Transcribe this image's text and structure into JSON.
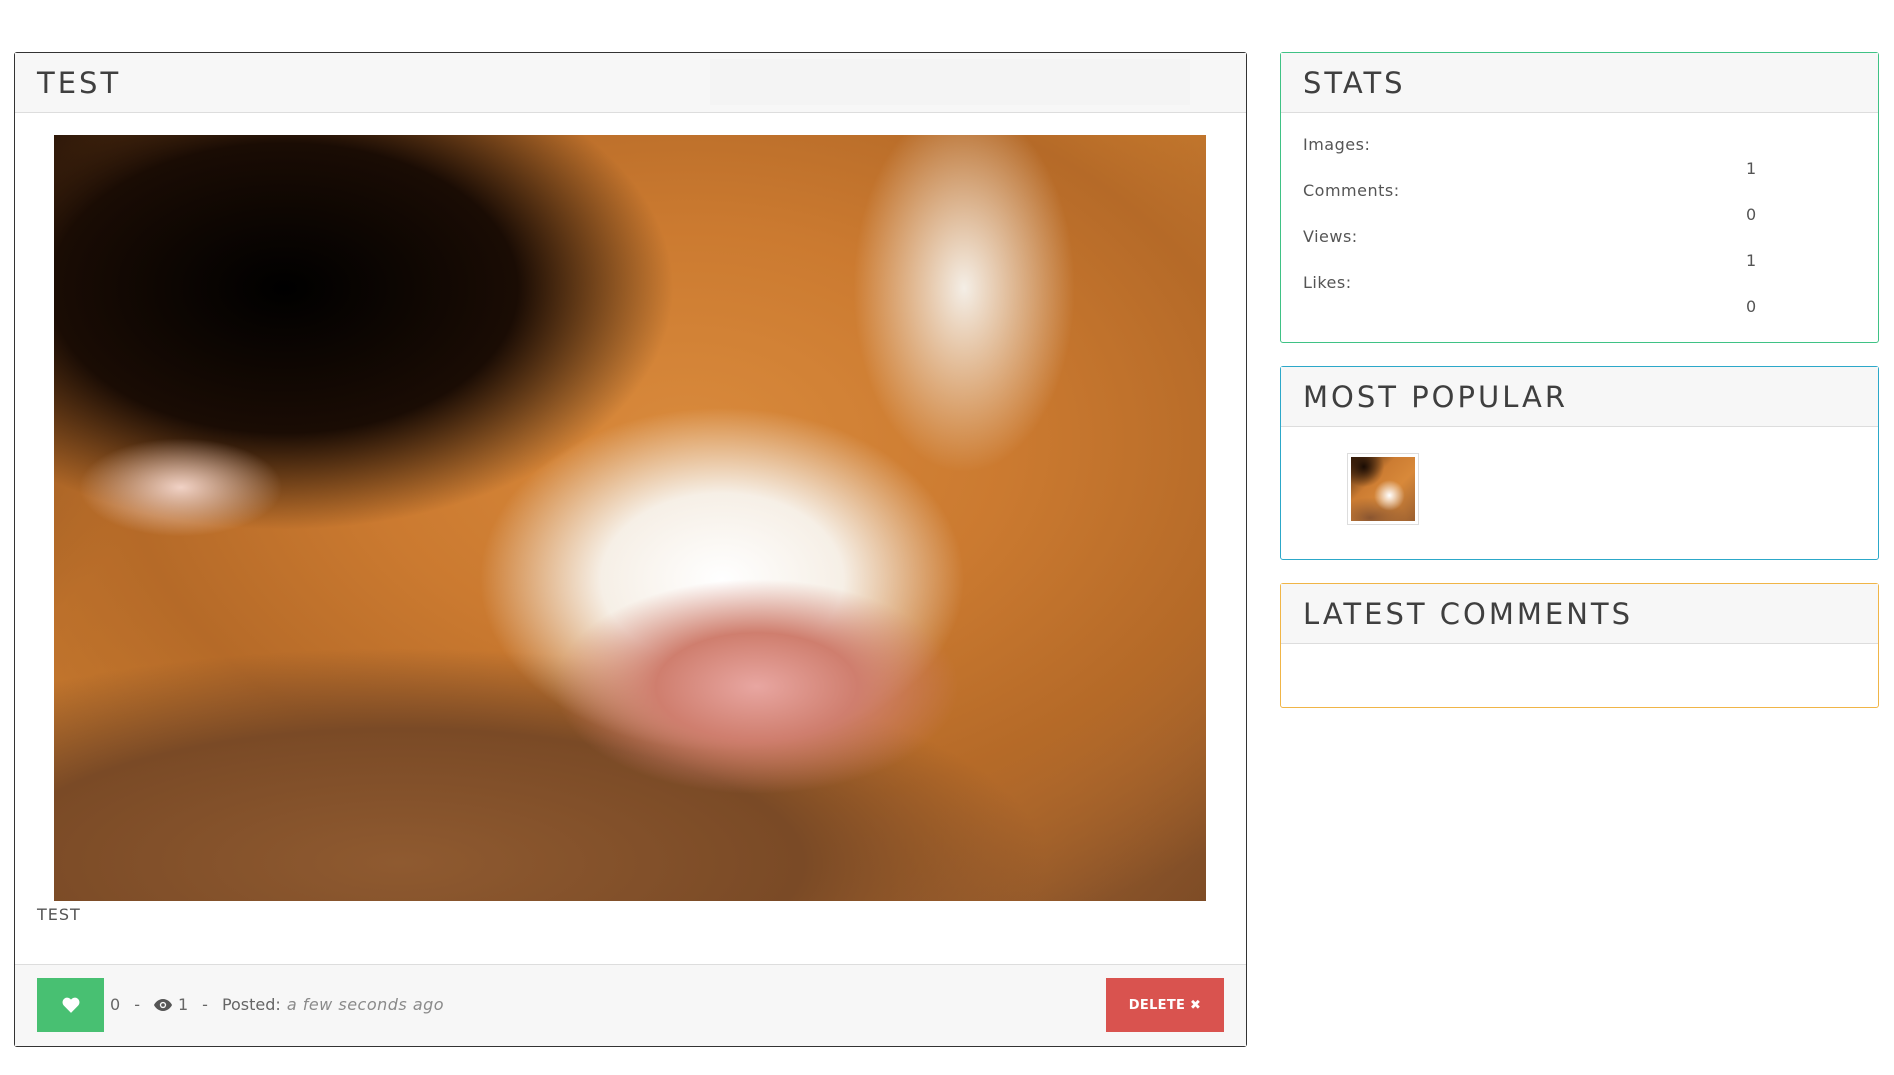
{
  "main": {
    "title": "TEST",
    "caption": "TEST",
    "likes": "0",
    "separator": "-",
    "views": "1",
    "posted_label": "Posted:",
    "posted_time": "a few seconds ago",
    "delete_label": "DELETE ✖",
    "like_icon": "heart-icon",
    "views_icon": "eye-icon",
    "colors": {
      "like": "#48c072",
      "delete": "#d9534f"
    }
  },
  "stats": {
    "title": "STATS",
    "items": [
      {
        "label": "Images:",
        "value": "1"
      },
      {
        "label": "Comments:",
        "value": "0"
      },
      {
        "label": "Views:",
        "value": "1"
      },
      {
        "label": "Likes:",
        "value": "0"
      }
    ],
    "border_color": "#3fc285"
  },
  "popular": {
    "title": "MOST POPULAR",
    "border_color": "#2ca8c9"
  },
  "comments": {
    "title": "LATEST COMMENTS",
    "border_color": "#f0b547"
  }
}
